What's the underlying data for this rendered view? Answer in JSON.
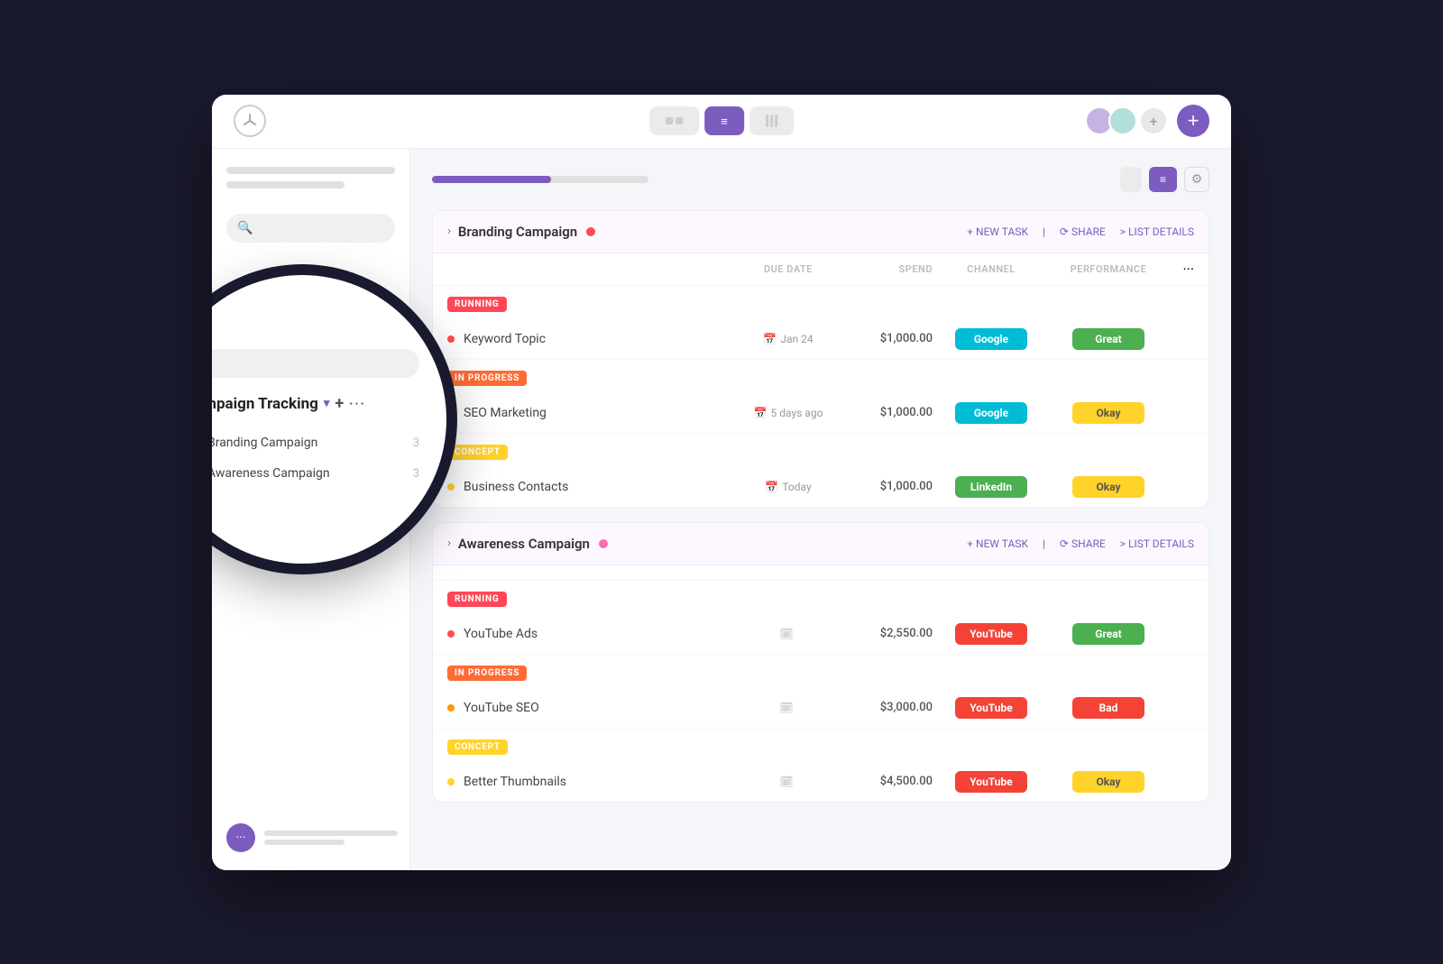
{
  "window": {
    "title": "Campaign Tracking"
  },
  "topbar": {
    "view_list_label": "≡",
    "view_btn1_label": "",
    "view_btn2_label": "",
    "plus_label": "+"
  },
  "sidebar": {
    "section_title": "Campaign Tracking",
    "items": [
      {
        "label": "Branding Campaign",
        "dot": "red",
        "badge": "3"
      },
      {
        "label": "Awareness Campaign",
        "dot": "pink",
        "badge": "3"
      }
    ],
    "search_placeholder": "Search"
  },
  "content": {
    "header_controls": {
      "btn1": "",
      "btn2": "≡",
      "btn3": ""
    },
    "campaigns": [
      {
        "title": "Branding Campaign",
        "dot_color": "#ff4d4d",
        "new_task": "+ NEW TASK",
        "share": "⟳ SHARE",
        "list_details": "> LIST DETAILS",
        "sections": [
          {
            "status": "RUNNING",
            "status_class": "status-running",
            "tasks": [
              {
                "name": "Keyword Topic",
                "color": "#ff4d4d",
                "due": "Jan 24",
                "spend": "$1,000.00",
                "channel": "Google",
                "channel_class": "ch-google",
                "performance": "Great",
                "perf_class": "perf-great"
              }
            ]
          },
          {
            "status": "IN PROGRESS",
            "status_class": "status-in-progress",
            "tasks": [
              {
                "name": "SEO Marketing",
                "color": "#ff9800",
                "due": "5 days ago",
                "spend": "$1,000.00",
                "channel": "Google",
                "channel_class": "ch-google",
                "performance": "Okay",
                "perf_class": "perf-okay"
              }
            ]
          },
          {
            "status": "CONCEPT",
            "status_class": "status-concept",
            "tasks": [
              {
                "name": "Business Contacts",
                "color": "#ffd32a",
                "due": "Today",
                "spend": "$1,000.00",
                "channel": "LinkedIn",
                "channel_class": "ch-linkedin",
                "performance": "Okay",
                "perf_class": "perf-okay"
              }
            ]
          }
        ]
      },
      {
        "title": "Awareness Campaign",
        "dot_color": "#ff69b4",
        "new_task": "+ NEW TASK",
        "share": "⟳ SHARE",
        "list_details": "> LIST DETAILS",
        "sections": [
          {
            "status": "RUNNING",
            "status_class": "status-running",
            "tasks": [
              {
                "name": "YouTube Ads",
                "color": "#ff4d4d",
                "due": "",
                "spend": "$2,550.00",
                "channel": "YouTube",
                "channel_class": "ch-youtube",
                "performance": "Great",
                "perf_class": "perf-great"
              }
            ]
          },
          {
            "status": "IN PROGRESS",
            "status_class": "status-in-progress",
            "tasks": [
              {
                "name": "YouTube SEO",
                "color": "#ff9800",
                "due": "",
                "spend": "$3,000.00",
                "channel": "YouTube",
                "channel_class": "ch-youtube",
                "performance": "Bad",
                "perf_class": "perf-bad"
              }
            ]
          },
          {
            "status": "CONCEPT",
            "status_class": "status-concept",
            "tasks": [
              {
                "name": "Better Thumbnails",
                "color": "#ffd32a",
                "due": "",
                "spend": "$4,500.00",
                "channel": "YouTube",
                "channel_class": "ch-youtube",
                "performance": "Okay",
                "perf_class": "perf-okay"
              }
            ]
          }
        ]
      }
    ],
    "table_cols": {
      "due": "DUE DATE",
      "spend": "SPEND",
      "channel": "CHANNEL",
      "performance": "PERFORMANCE"
    }
  },
  "zoom": {
    "section_title": "Campaign Tracking",
    "items": [
      {
        "label": "Branding Campaign",
        "dot": "red",
        "badge": "3"
      },
      {
        "label": "Awareness Campaign",
        "dot": "pink",
        "badge": "3"
      }
    ]
  }
}
